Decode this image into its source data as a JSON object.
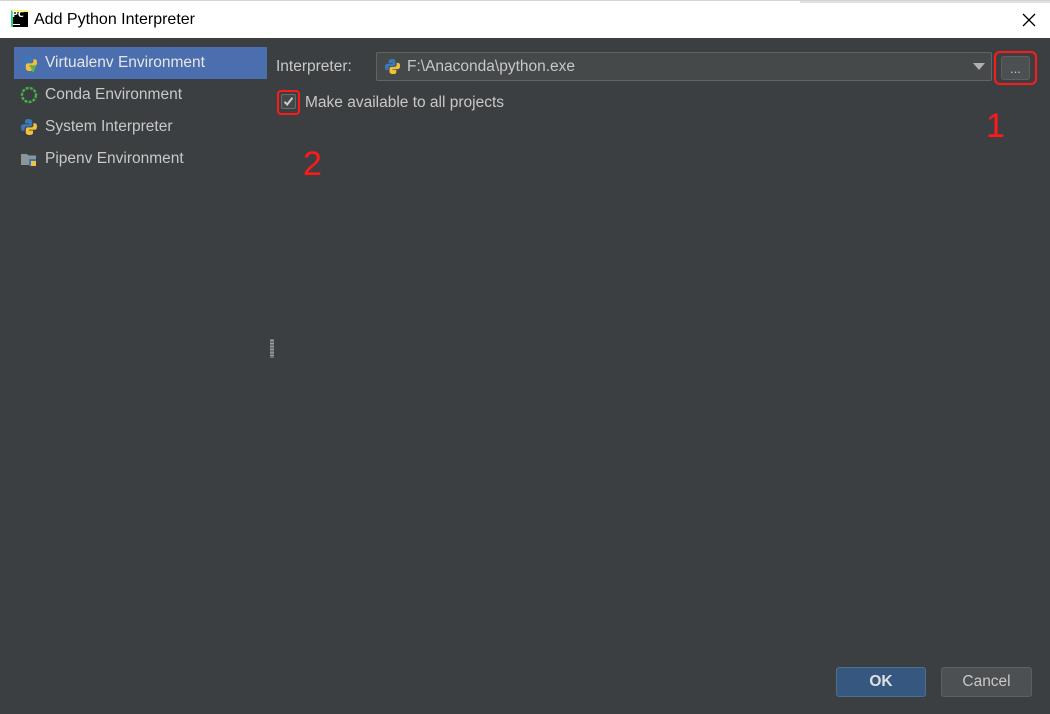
{
  "window": {
    "title": "Add Python Interpreter",
    "app_icon_text": "PC"
  },
  "sidebar": {
    "items": [
      {
        "label": "Virtualenv Environment",
        "icon": "virtualenv-icon",
        "selected": true
      },
      {
        "label": "Conda Environment",
        "icon": "conda-icon",
        "selected": false
      },
      {
        "label": "System Interpreter",
        "icon": "python-icon",
        "selected": false
      },
      {
        "label": "Pipenv Environment",
        "icon": "pipenv-icon",
        "selected": false
      }
    ]
  },
  "main": {
    "interpreter_label": "Interpreter:",
    "interpreter_value": "F:\\Anaconda\\python.exe",
    "browse_label": "...",
    "make_available_label": "Make available to all projects",
    "make_available_checked": true,
    "annotations": [
      "1",
      "2"
    ]
  },
  "footer": {
    "ok_label": "OK",
    "cancel_label": "Cancel"
  },
  "colors": {
    "background": "#3c3f41",
    "selection": "#4b6eaf",
    "primary_button": "#365880",
    "annotation": "#ff1a1a"
  }
}
